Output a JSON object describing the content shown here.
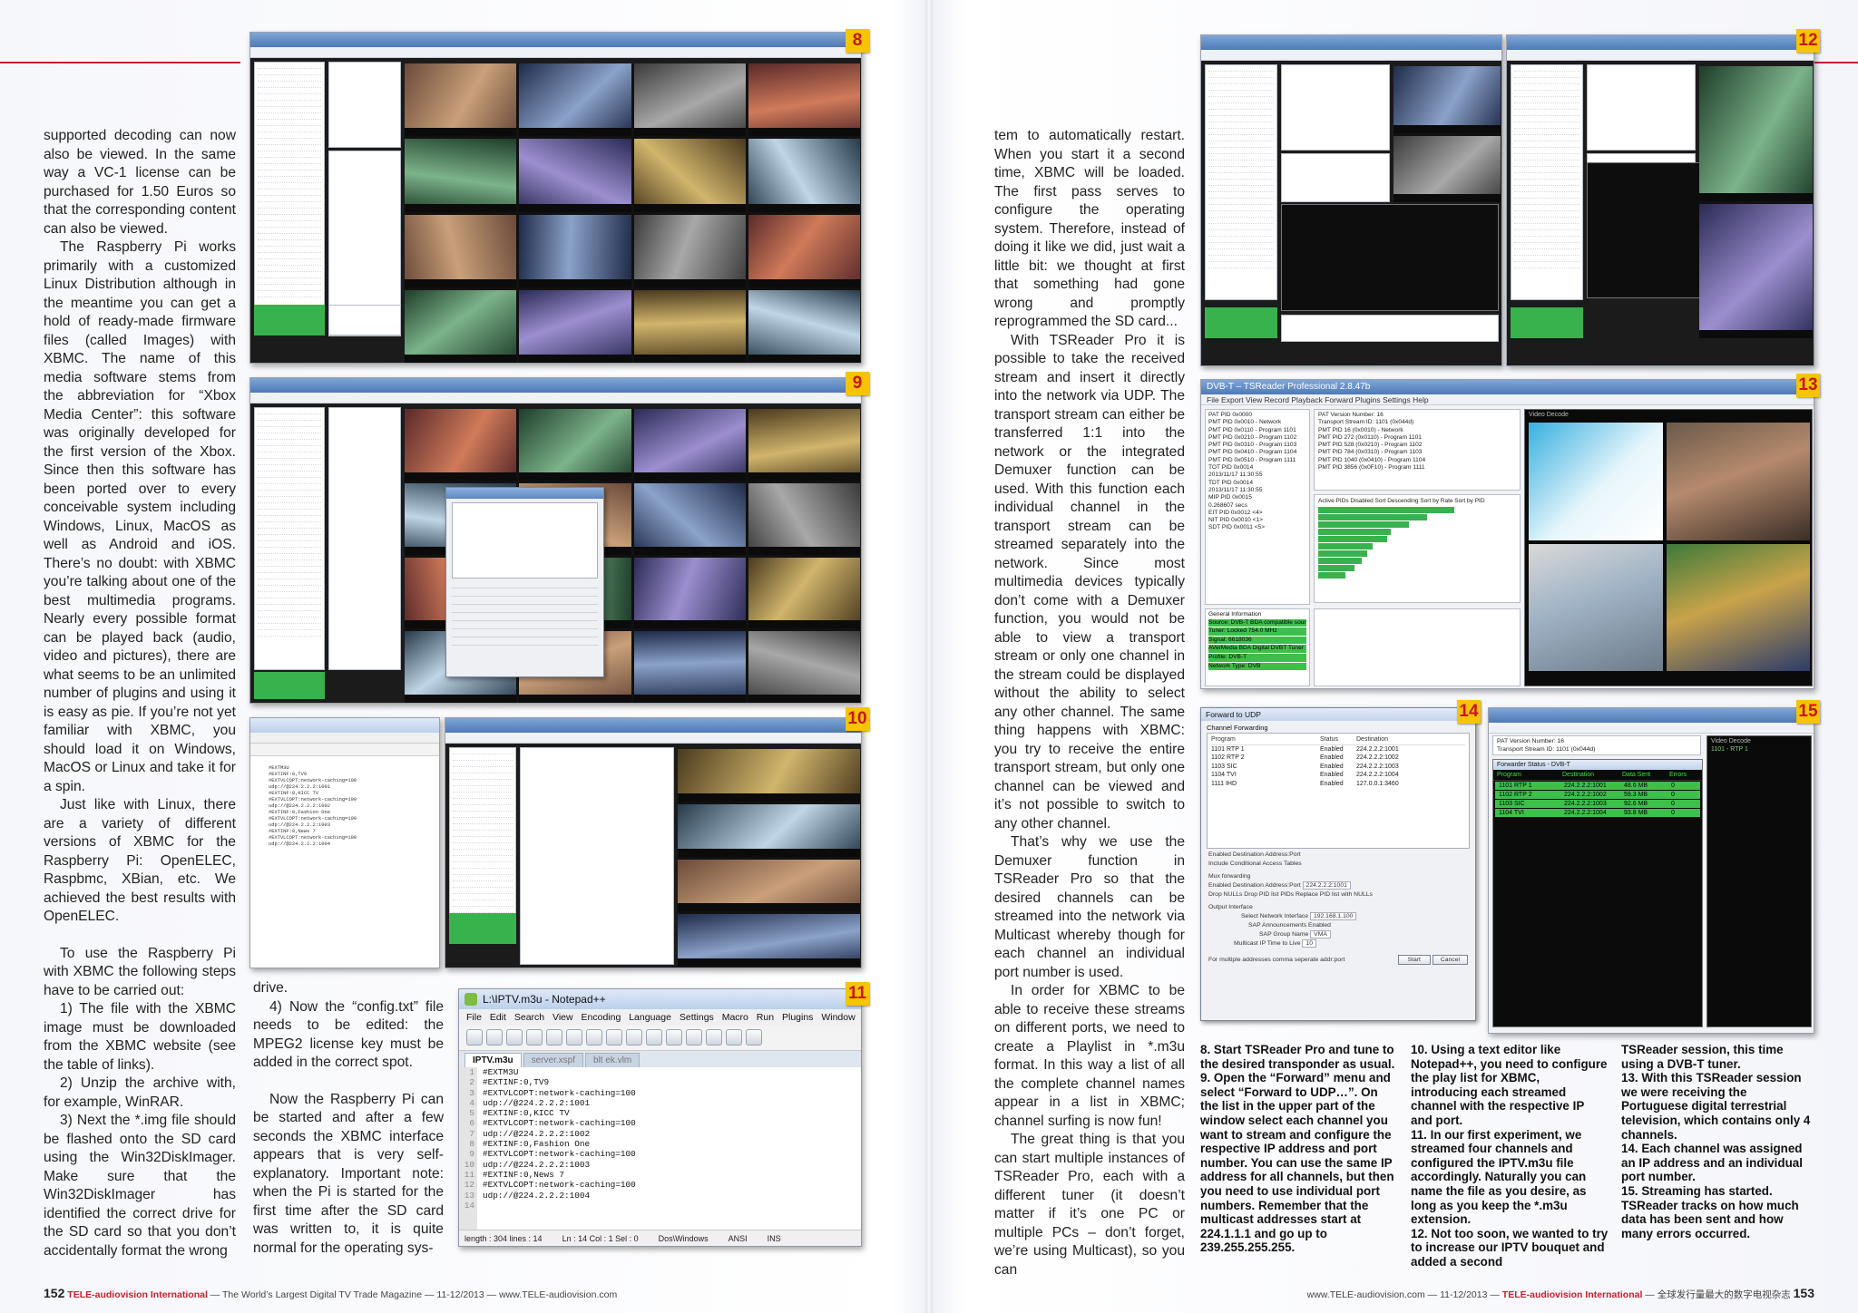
{
  "left_page": {
    "col1": [
      {
        "text": "supported decoding can now also be viewed. In the same way a VC-1 license can be purchased for 1.50 Euros so that the corresponding content can also be viewed.",
        "first": true
      },
      {
        "text": "The Raspberry Pi works primarily with a customized Linux Distribution although in the meantime you can get a hold of ready-made firmware files (called Images) with XBMC. The name of this media software stems from the abbreviation for “Xbox Media Center”: this software was originally developed for the first version of the Xbox. Since then this software has been ported over to every conceivable system including Windows, Linux, MacOS as well as Android and iOS. There’s no doubt: with XBMC you’re talking about one of the best multimedia programs. Nearly every possible format can be played back (audio, video and pictures), there are what seems to be an unlimited number of plugins and using it is easy as pie. If you’re not yet familiar with XBMC, you should load it on Windows, MacOS or Linux and take it for a spin."
      },
      {
        "text": "Just like with Linux, there are a variety of different versions of XBMC for the Raspberry Pi: OpenELEC, Raspbmc, XBian, etc. We achieved the best results with OpenELEC."
      },
      {
        "text": "To use the Raspberry Pi with XBMC the following steps have to be carried out:",
        "gap": true
      },
      {
        "text": "1) The file with the XBMC image must be downloaded from the XBMC website (see the table of links)."
      },
      {
        "text": "2) Unzip the archive with, for example, WinRAR."
      },
      {
        "text": "3) Next the *.img file should be flashed onto the SD card using the Win32DiskImager. Make sure that the Win32DiskImager has identified the correct drive for the SD card so that you don’t accidentally format the wrong"
      }
    ],
    "col2": [
      {
        "text": "drive.",
        "first": true
      },
      {
        "text": "4) Now the “config.txt” file needs to be edited: the MPEG2 license key must be added in the correct spot."
      },
      {
        "text": "Now the Raspberry Pi can be started and after a few seconds the XBMC interface appears that is very self-explanatory. Important note: when the Pi is started for the first time after the SD card was written to, it is quite normal for the operating sys-",
        "gap": true
      }
    ],
    "footer": {
      "page": "152",
      "brand": "TELE-audiovision International",
      "tagline": " — The World’s Largest Digital TV Trade Magazine — 11-12/2013 — www.TELE-audiovision.com"
    }
  },
  "right_page": {
    "col1": [
      {
        "text": "tem to automatically restart. When you start it a second time, XBMC will be loaded. The first pass serves to configure the operating system. Therefore, instead of doing it like we did, just wait a little bit: we thought at first that something had gone wrong and promptly reprogrammed the SD card...",
        "first": true
      },
      {
        "text": "With TSReader Pro it is possible to take the received stream and insert it directly into the network via UDP. The transport stream can either be transferred 1:1 into the network or the integrated Demuxer function can be used. With this function each individual channel in the transport stream can be streamed separately into the network. Since most multimedia devices typically don’t come with a Demuxer function, you would not be able to view a transport stream or only one channel in the stream could be displayed without the ability to select any other channel. The same thing happens with XBMC: you try to receive the entire transport stream, but only one channel can be viewed and it’s not possible to switch to any other channel."
      },
      {
        "text": "That’s why we use the Demuxer function in TSReader Pro so that the desired channels can be streamed into the network via Multicast whereby though for each channel an individual port number is used."
      },
      {
        "text": "In order for XBMC to be able to receive these streams on different ports, we need to create a Playlist in *.m3u format. In this way a list of all the complete channel names appear in a list in XBMC; channel surfing is now fun!"
      },
      {
        "text": "The great thing is that you can start multiple instances of TSReader Pro, each with a different tuner (it doesn’t matter if it’s one PC or multiple PCs – don’t forget, we’re using Multicast), so you can"
      }
    ],
    "captions_a": [
      "8. Start TSReader Pro and tune to the desired transponder as usual.",
      "9. Open the “Forward” menu and select “Forward to UDP…”. On the list in the upper part of the window select each channel you want to stream and configure the respective IP address and port number. You can use the same IP address for all channels, but then you need to use individual port numbers. Remember that the multicast addresses start at 224.1.1.1 and go up to 239.255.255.255."
    ],
    "captions_b": [
      "10. Using a text editor like Notepad++, you need to configure the play list for XBMC, introducing each streamed channel with the respective IP and port.",
      "11. In our first experiment, we streamed four channels and configured the IPTV.m3u file accordingly. Naturally you can name the file as you desire, as long as you keep the *.m3u extension.",
      "12. Not too soon, we wanted to try to increase our IPTV bouquet and added a second"
    ],
    "captions_c": [
      "TSReader session, this time using a DVB-T tuner.",
      "13. With this TSReader session we were receiving the Portuguese digital terrestrial television, which contains only 4 channels.",
      "14. Each channel was assigned an IP address and an individual port number.",
      "15. Streaming has started. TSReader tracks on how much data has been sent and how many errors occurred."
    ],
    "footer": {
      "url": "www.TELE-audiovision.com — 11-12/2013 — ",
      "brand": "TELE-audiovision International",
      "tagline": " — 全球发行量最大的数字电视杂志",
      "page": "153"
    }
  },
  "figures": {
    "badges": [
      "8",
      "9",
      "10",
      "11",
      "12",
      "13",
      "14",
      "15"
    ],
    "fig13": {
      "title": "DVB-T – TSReader Professional 2.8.47b",
      "menu": "File   Export   View   Record   Playback   Forward   Plugins   Settings   Help",
      "tree": [
        "PAT PID 0x0000",
        "PMT PID 0x0010 - Network",
        "PMT PID 0x0110 - Program 1101",
        "PMT PID 0x0210 - Program 1102",
        "PMT PID 0x0310 - Program 1103",
        "PMT PID 0x0410 - Program 1104",
        "PMT PID 0x0510 - Program 1111",
        "TOT PID 0x0014",
        "2013/11/17 11:30:55",
        "TDT PID 0x0014",
        "2013/11/17 11:30:55",
        "MIP PID 0x0015",
        "0.268607 secs",
        "EIT PID 0x0012 <4>",
        "NIT PID 0x0010 <1>",
        "SDT PID 0x0011 <5>"
      ],
      "pat": [
        "PAT Version Number: 16",
        "Transport Stream ID: 1101 (0x044d)",
        "",
        "PMT PID 16 (0x0010) - Network",
        "PMT PID 272 (0x0110) - Program 1101",
        "PMT PID 528 (0x0210) - Program 1102",
        "PMT PID 784 (0x0310) - Program 1103",
        "PMT PID 1040 (0x0410) - Program 1104",
        "PMT PID 3856 (0x0F10) - Program 1111"
      ],
      "general": [
        "General Information",
        "Source: DVB-T BDA compatible source",
        "Tuner: Locked 754.0 MHz",
        "Signal: 6618036",
        "AVerMedia BDA Digital DVBT Tuner",
        "Profile: DVB-T",
        "Network Type: DVB"
      ],
      "video_label": "Video Decode"
    },
    "fig14": {
      "title": "Forward to UDP",
      "group": "Channel Forwarding",
      "cols": [
        "Program",
        "Status",
        "Destination"
      ],
      "rows": [
        [
          "1101 RTP 1",
          "Enabled",
          "224.2.2.2:1001"
        ],
        [
          "1102 RTP 2",
          "Enabled",
          "224.2.2.2:1002"
        ],
        [
          "1103 SIC",
          "Enabled",
          "224.2.2.2:1003"
        ],
        [
          "1104 TVI",
          "Enabled",
          "224.2.2.2:1004"
        ],
        [
          "1111 IHD",
          "Enabled",
          "127.0.0.1:3460"
        ]
      ],
      "enabled_label": "Enabled",
      "dest_label": "Destination Address:Port",
      "cond_label": "Include Conditional Access Tables",
      "mux_label": "Mux forwarding",
      "mux_dest": "224.2.2.2:1001",
      "drop_nulls": "Drop NULLs",
      "drop_pid": "Drop PID list PIDs",
      "replace_pid": "Replace PID list with NULLs",
      "out_label": "Output Interface",
      "sel_nic": "Select Network Interface",
      "nic": "192.168.1.100",
      "sap_ann": "SAP Announcements",
      "sap_val": "Enabled",
      "sap_group": "SAP Group Name",
      "sap_group_val": "VMA",
      "ttl": "Multicast IP Time to Live",
      "ttl_val": "10",
      "note": "For multiple addresses comma seperate addr:port",
      "start": "Start",
      "cancel": "Cancel"
    },
    "fig15": {
      "title": "Forwarder Status - DVB-T",
      "pat": [
        "PAT Version Number: 16",
        "Transport Stream ID: 1101 (0x044d)"
      ],
      "cols": [
        "Program",
        "Destination",
        "Data Sent",
        "Errors"
      ],
      "rows": [
        [
          "1101 RTP 1",
          "224.2.2.2:1001",
          "48.6 MB",
          "0"
        ],
        [
          "1102 RTP 2",
          "224.2.2.2:1002",
          "59.3 MB",
          "0"
        ],
        [
          "1103 SIC",
          "224.2.2.2:1003",
          "92.6 MB",
          "0"
        ],
        [
          "1104 TVI",
          "224.2.2.2:1004",
          "93.8 MB",
          "0"
        ]
      ],
      "video_label": "Video Decode",
      "channel": "1101 - RTP 1"
    },
    "fig11": {
      "title": "L:\\IPTV.m3u - Notepad++",
      "menu": "File  Edit  Search  View  Encoding  Language  Settings  Macro  Run  Plugins  Window  ?",
      "tabs": [
        "IPTV.m3u",
        "server.xspf",
        "blt ek.vlm"
      ],
      "lines": [
        "#EXTM3U",
        "#EXTINF:0,TV9",
        "#EXTVLCOPT:network-caching=100",
        "udp://@224.2.2.2:1001",
        "#EXTINF:0,KICC TV",
        "#EXTVLCOPT:network-caching=100",
        "udp://@224.2.2.2:1002",
        "#EXTINF:0,Fashion One",
        "#EXTVLCOPT:network-caching=100",
        "udp://@224.2.2.2:1003",
        "#EXTINF:0,News 7",
        "#EXTVLCOPT:network-caching=100",
        "udp://@224.2.2.2:1004",
        ""
      ],
      "status": [
        "length : 304    lines : 14",
        "Ln : 14    Col : 1    Sel : 0",
        "Dos\\Windows",
        "ANSI",
        "INS"
      ]
    }
  }
}
